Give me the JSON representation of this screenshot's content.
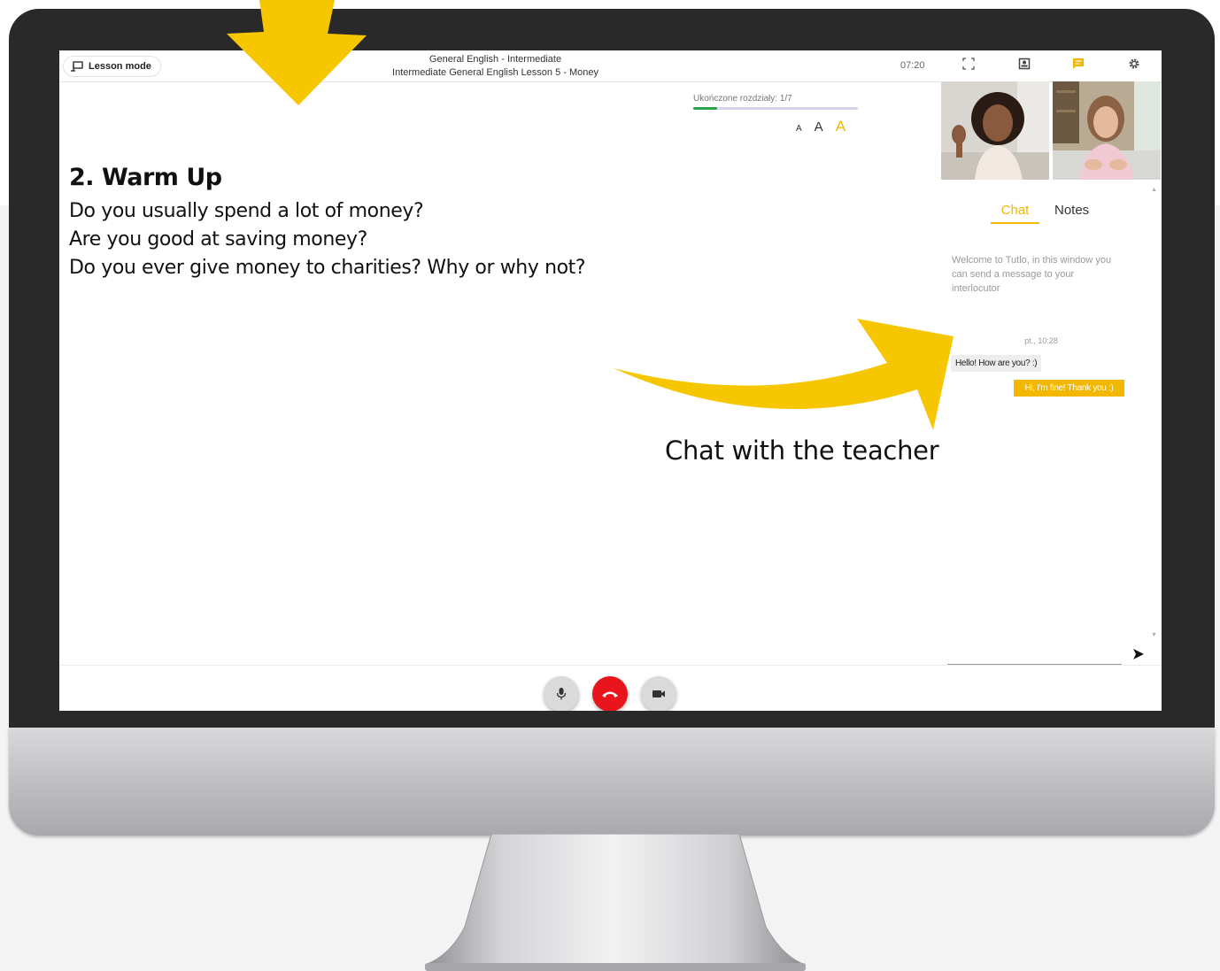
{
  "app": {
    "lesson_mode_label": "Lesson mode",
    "course_title": "General English - Intermediate",
    "lesson_title": "Intermediate General English Lesson 5 - Money",
    "timer": "07:20"
  },
  "toolbar": {
    "icons": [
      "fullscreen-icon",
      "contact-card-icon",
      "chat-icon",
      "settings-icon"
    ],
    "active_icon": "chat-icon"
  },
  "progress": {
    "label": "Ukończone rozdziały: 1/7",
    "completed": 1,
    "total": 7
  },
  "font_size_controls": [
    "A",
    "A",
    "A"
  ],
  "lesson": {
    "section_title": "2. Warm Up",
    "questions": [
      "Do you usually spend a lot of money?",
      "Are you good at saving money?",
      "Do you ever give money to charities? Why or why not?"
    ]
  },
  "sidebar": {
    "tabs": {
      "chat": "Chat",
      "notes": "Notes"
    },
    "active_tab": "Chat",
    "welcome_message": "Welcome to Tutlo, in this window you can send a message to your interlocutor",
    "timestamp": "pt., 10:28",
    "messages": [
      {
        "direction": "incoming",
        "text": "Hello! How are you? :)"
      },
      {
        "direction": "outgoing",
        "text": "Hi, I'm fine! Thank you :)"
      }
    ]
  },
  "controls": {
    "icons": [
      "microphone-icon",
      "end-call-icon",
      "camera-icon"
    ]
  },
  "annotation": {
    "label": "Chat with the teacher"
  },
  "colors": {
    "accent": "#f3b700",
    "end_call": "#e8151c",
    "progress": "#2aa24a",
    "bezel": "#292929"
  }
}
